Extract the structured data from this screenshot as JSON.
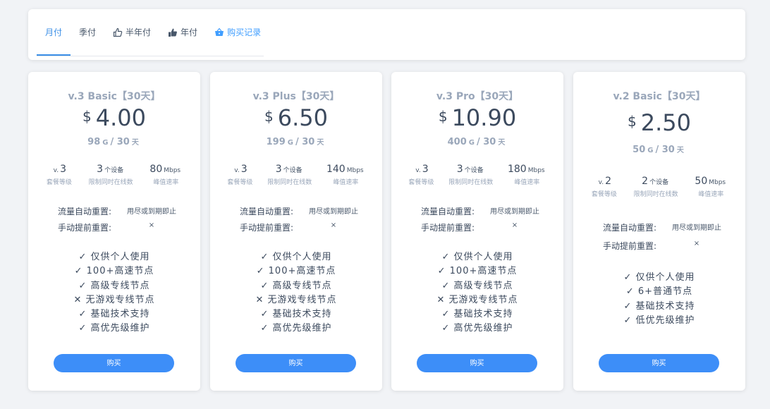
{
  "tabs": [
    {
      "label": "月付",
      "icon": "",
      "active": true
    },
    {
      "label": "季付",
      "icon": ""
    },
    {
      "label": "半年付",
      "icon": "thumbs-up-outline-icon"
    },
    {
      "label": "年付",
      "icon": "thumbs-up-filled-icon"
    },
    {
      "label": "购买记录",
      "icon": "basket-icon"
    }
  ],
  "plans": [
    {
      "name": "v.3 Basic【30天】",
      "currency": "$",
      "price": "4.00",
      "quota": "98",
      "quota_unit": "G",
      "quota_sep": "/",
      "period": "30",
      "period_unit": "天",
      "level_prefix": "v.",
      "level": "3",
      "level_label": "套餐等级",
      "devices": "3",
      "devices_unit": "个设备",
      "devices_label": "限制同时在线数",
      "speed": "80",
      "speed_unit": "Mbps",
      "speed_label": "峰值速率",
      "auto_reset_label": "流量自动重置:",
      "auto_reset_value": "用尽或到期即止",
      "manual_reset_label": "手动提前重置:",
      "manual_reset_value": "×",
      "features": [
        "✓ 仅供个人使用",
        "✓ 100+高速节点",
        "✓ 高级专线节点",
        "✕ 无游戏专线节点",
        "✓ 基础技术支持",
        "✓ 高优先级维护"
      ],
      "buy_label": "购买"
    },
    {
      "name": "v.3 Plus【30天】",
      "currency": "$",
      "price": "6.50",
      "quota": "199",
      "quota_unit": "G",
      "quota_sep": "/",
      "period": "30",
      "period_unit": "天",
      "level_prefix": "v.",
      "level": "3",
      "level_label": "套餐等级",
      "devices": "3",
      "devices_unit": "个设备",
      "devices_label": "限制同时在线数",
      "speed": "140",
      "speed_unit": "Mbps",
      "speed_label": "峰值速率",
      "auto_reset_label": "流量自动重置:",
      "auto_reset_value": "用尽或到期即止",
      "manual_reset_label": "手动提前重置:",
      "manual_reset_value": "×",
      "features": [
        "✓ 仅供个人使用",
        "✓ 100+高速节点",
        "✓ 高级专线节点",
        "✕ 无游戏专线节点",
        "✓ 基础技术支持",
        "✓ 高优先级维护"
      ],
      "buy_label": "购买"
    },
    {
      "name": "v.3 Pro【30天】",
      "currency": "$",
      "price": "10.90",
      "quota": "400",
      "quota_unit": "G",
      "quota_sep": "/",
      "period": "30",
      "period_unit": "天",
      "level_prefix": "v.",
      "level": "3",
      "level_label": "套餐等级",
      "devices": "3",
      "devices_unit": "个设备",
      "devices_label": "限制同时在线数",
      "speed": "180",
      "speed_unit": "Mbps",
      "speed_label": "峰值速率",
      "auto_reset_label": "流量自动重置:",
      "auto_reset_value": "用尽或到期即止",
      "manual_reset_label": "手动提前重置:",
      "manual_reset_value": "×",
      "features": [
        "✓ 仅供个人使用",
        "✓ 100+高速节点",
        "✓ 高级专线节点",
        "✕ 无游戏专线节点",
        "✓ 基础技术支持",
        "✓ 高优先级维护"
      ],
      "buy_label": "购买"
    },
    {
      "name": "v.2 Basic【30天】",
      "currency": "$",
      "price": "2.50",
      "quota": "50",
      "quota_unit": "G",
      "quota_sep": "/",
      "period": "30",
      "period_unit": "天",
      "level_prefix": "v.",
      "level": "2",
      "level_label": "套餐等级",
      "devices": "2",
      "devices_unit": "个设备",
      "devices_label": "限制同时在线数",
      "speed": "50",
      "speed_unit": "Mbps",
      "speed_label": "峰值速率",
      "auto_reset_label": "流量自动重置:",
      "auto_reset_value": "用尽或到期即止",
      "manual_reset_label": "手动提前重置:",
      "manual_reset_value": "×",
      "features": [
        "✓ 仅供个人使用",
        "✓ 6+普通节点",
        "✓ 基础技术支持",
        "✓ 低优先级维护"
      ],
      "buy_label": "购买"
    }
  ],
  "colors": {
    "accent": "#3d8ef8",
    "tab_active": "#3a8ee6",
    "muted": "#9aa7ba",
    "text": "#3c4a5e"
  }
}
